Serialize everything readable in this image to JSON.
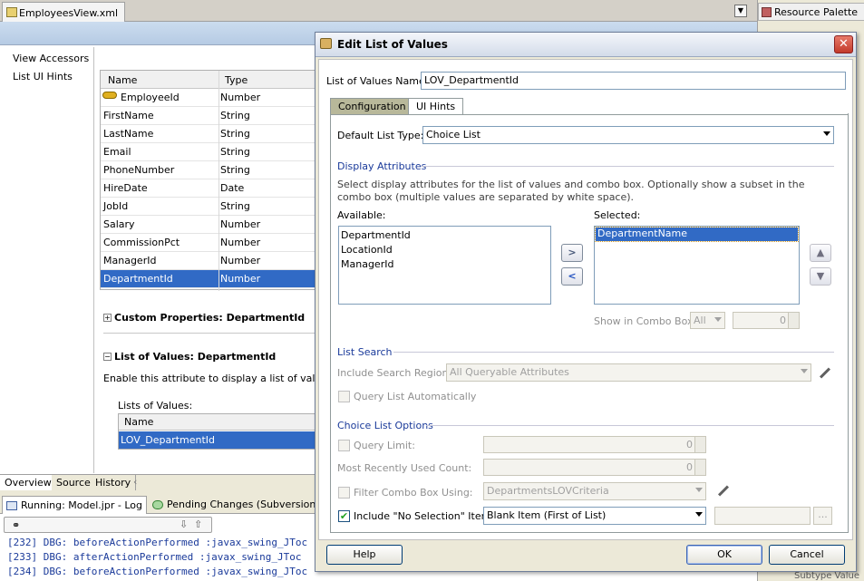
{
  "editor": {
    "tab_label": "EmployeesView.xml"
  },
  "resource_palette": {
    "title": "Resource Palette"
  },
  "nav": {
    "items": [
      "View Accessors",
      "List UI Hints"
    ]
  },
  "attr_grid": {
    "headers": [
      "Name",
      "Type"
    ],
    "rows": [
      {
        "name": "EmployeeId",
        "type": "Number"
      },
      {
        "name": "FirstName",
        "type": "String"
      },
      {
        "name": "LastName",
        "type": "String"
      },
      {
        "name": "Email",
        "type": "String"
      },
      {
        "name": "PhoneNumber",
        "type": "String"
      },
      {
        "name": "HireDate",
        "type": "Date"
      },
      {
        "name": "JobId",
        "type": "String"
      },
      {
        "name": "Salary",
        "type": "Number"
      },
      {
        "name": "CommissionPct",
        "type": "Number"
      },
      {
        "name": "ManagerId",
        "type": "Number"
      },
      {
        "name": "DepartmentId",
        "type": "Number"
      }
    ],
    "selected_index": 10
  },
  "sections": {
    "custom_props": "Custom Properties: DepartmentId",
    "lov": "List of Values: DepartmentId",
    "lov_help": "Enable this attribute to display a list of values to",
    "lists_label": "Lists of Values:",
    "lists_header": "Name",
    "lists_row": "LOV_DepartmentId"
  },
  "bottom_tabs": [
    "Overview",
    "Source",
    "History"
  ],
  "log": {
    "tabs": [
      "Running: Model.jpr - Log",
      "Pending Changes (Subversion)"
    ],
    "lines": [
      "[232] DBG: beforeActionPerformed :javax_swing_JToc",
      "[233] DBG: afterActionPerformed :javax_swing_JToc",
      "[234] DBG: beforeActionPerformed :javax_swing_JToc"
    ]
  },
  "dialog": {
    "title": "Edit List of Values",
    "lov_name_label": "List of Values Name:",
    "lov_name_value": "LOV_DepartmentId",
    "tabs": [
      "Configuration",
      "UI Hints"
    ],
    "default_list_type_label": "Default List Type:",
    "default_list_type_value": "Choice List",
    "display_attrs_title": "Display Attributes",
    "display_attrs_help": "Select display attributes for the list of values and combo box. Optionally show a subset in the combo box (multiple values are separated by white space).",
    "available_label": "Available:",
    "available_items": [
      "DepartmentId",
      "LocationId",
      "ManagerId"
    ],
    "selected_label": "Selected:",
    "selected_items": [
      "DepartmentName"
    ],
    "show_in_combo_label": "Show in Combo Box:",
    "show_in_combo_value": "All",
    "show_in_combo_count": "0",
    "list_search_title": "List Search",
    "include_search_label": "Include Search Region:",
    "include_search_value": "All Queryable Attributes",
    "query_auto_label": "Query List Automatically",
    "choice_options_title": "Choice List Options",
    "query_limit_label": "Query Limit:",
    "query_limit_value": "0",
    "mru_label": "Most Recently Used Count:",
    "mru_value": "0",
    "filter_label": "Filter Combo Box Using:",
    "filter_value": "DepartmentsLOVCriteria",
    "no_selection_label": "Include \"No Selection\" Item:",
    "no_selection_value": "Blank Item (First of List)",
    "no_selection_checked": true,
    "ellipsis": "...",
    "help_btn": "Help",
    "ok_btn": "OK",
    "cancel_btn": "Cancel"
  },
  "right_edge": {
    "bottom_text": "Subtype Value"
  }
}
